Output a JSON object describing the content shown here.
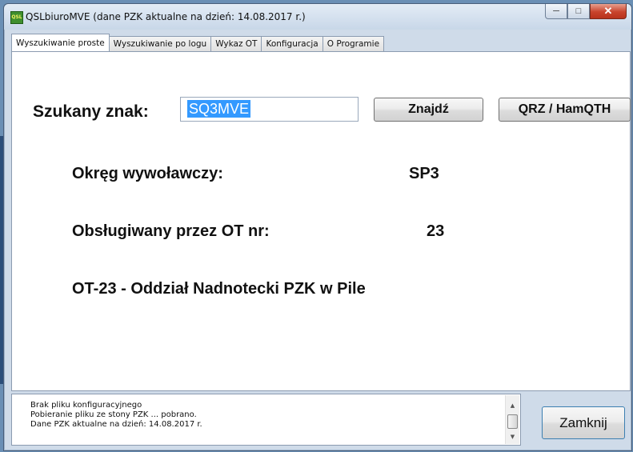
{
  "window": {
    "title": "QSLbiuroMVE (dane PZK aktualne na dzień: 14.08.2017 r.)",
    "icon": "app-icon",
    "controls": {
      "minimize": "─",
      "maximize": "□",
      "close": "✕"
    }
  },
  "tabs": [
    {
      "label": "Wyszukiwanie proste",
      "active": true
    },
    {
      "label": "Wyszukiwanie po logu",
      "active": false
    },
    {
      "label": "Wykaz OT",
      "active": false
    },
    {
      "label": "Konfiguracja",
      "active": false
    },
    {
      "label": "O Programie",
      "active": false
    }
  ],
  "search": {
    "label": "Szukany znak:",
    "value": "SQ3MVE",
    "find_button": "Znajdź",
    "qrz_button": "QRZ / HamQTH"
  },
  "result": {
    "district_label": "Okręg wywoławczy:",
    "district_value": "SP3",
    "ot_label": "Obsługiwany przez OT nr:",
    "ot_value": "23",
    "ot_name": "OT-23 - Oddział Nadnotecki PZK w Pile"
  },
  "log": {
    "lines": [
      "Brak pliku konfiguracyjnego",
      "Pobieranie pliku ze stony PZK ... pobrano.",
      "Dane PZK aktualne na dzień: 14.08.2017 r."
    ]
  },
  "close_button": "Zamknij",
  "colors": {
    "window_bg": "#cfdbe9",
    "selection": "#3399ff",
    "close_red": "#c8432c"
  }
}
